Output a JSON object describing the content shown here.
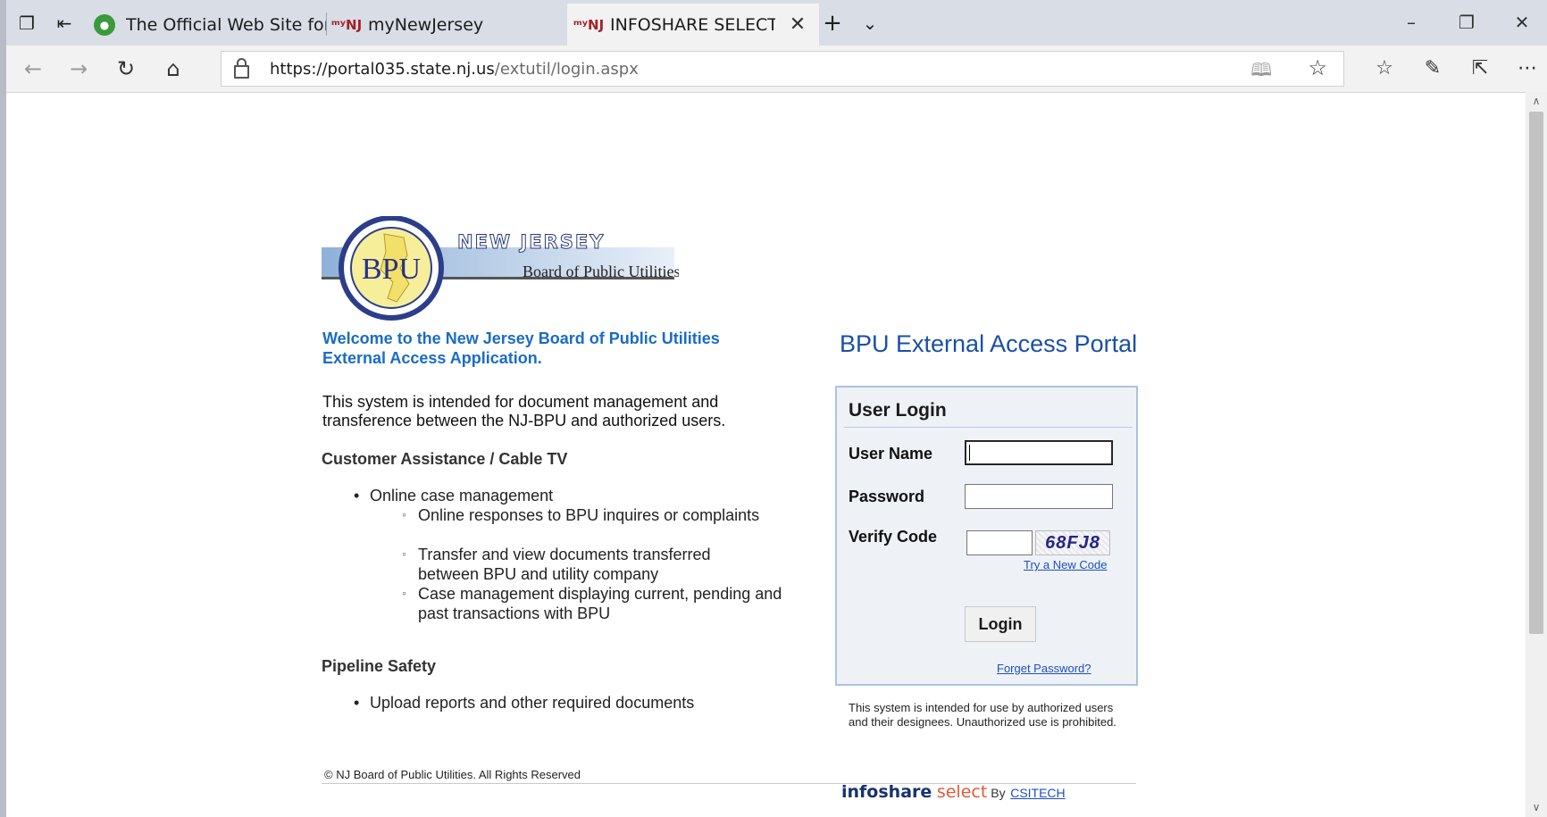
{
  "browser": {
    "tabs": [
      {
        "title": "The Official Web Site for Th",
        "favicon": "nj-seal-icon",
        "active": false
      },
      {
        "title": "myNewJersey",
        "favicon": "mynj-icon",
        "active": false
      },
      {
        "title": "INFOSHARE SELECT Log",
        "favicon": "mynj-icon",
        "active": true
      }
    ],
    "favicon_text": "my\nNJ",
    "url_host": "https://portal035.state.nj.us",
    "url_path": "/extutil/login.aspx"
  },
  "logo": {
    "seal_text": "BPU",
    "line1": "NEW JERSEY",
    "line2": "Board of Public Utilities"
  },
  "left": {
    "welcome": "Welcome to the New Jersey Board of Public Utilities External Access Application.",
    "intro": "This system is intended for document management and transference between the NJ-BPU and authorized users.",
    "section1_title": "Customer Assistance / Cable TV",
    "section1_bullet": "Online case management",
    "section1_subs": [
      "Online responses to BPU inquires or complaints",
      "Transfer and view documents transferred between BPU and utility company",
      "Case management displaying current, pending and past transactions with BPU"
    ],
    "section2_title": "Pipeline Safety",
    "section2_bullet": "Upload reports and other required documents",
    "copyright": "© NJ Board of Public Utilities. All Rights Reserved"
  },
  "right": {
    "portal_title": "BPU External Access Portal",
    "login_title": "User Login",
    "username_label": "User Name",
    "password_label": "Password",
    "verify_label": "Verify Code",
    "captcha_code": "68FJ8",
    "new_code_link": "Try a New Code",
    "login_button": "Login",
    "forget_link": "Forget Password?",
    "disclaimer": "This system is intended for use by authorized users and their designees. Unauthorized use is prohibited.",
    "brand_infoshare": "infoshare",
    "brand_select": "select",
    "brand_by": "By",
    "brand_csitech": "CSITECH"
  },
  "colors": {
    "accent_blue": "#1a6cc4",
    "portal_blue": "#1a4faa",
    "login_border": "#a9c3e2"
  }
}
